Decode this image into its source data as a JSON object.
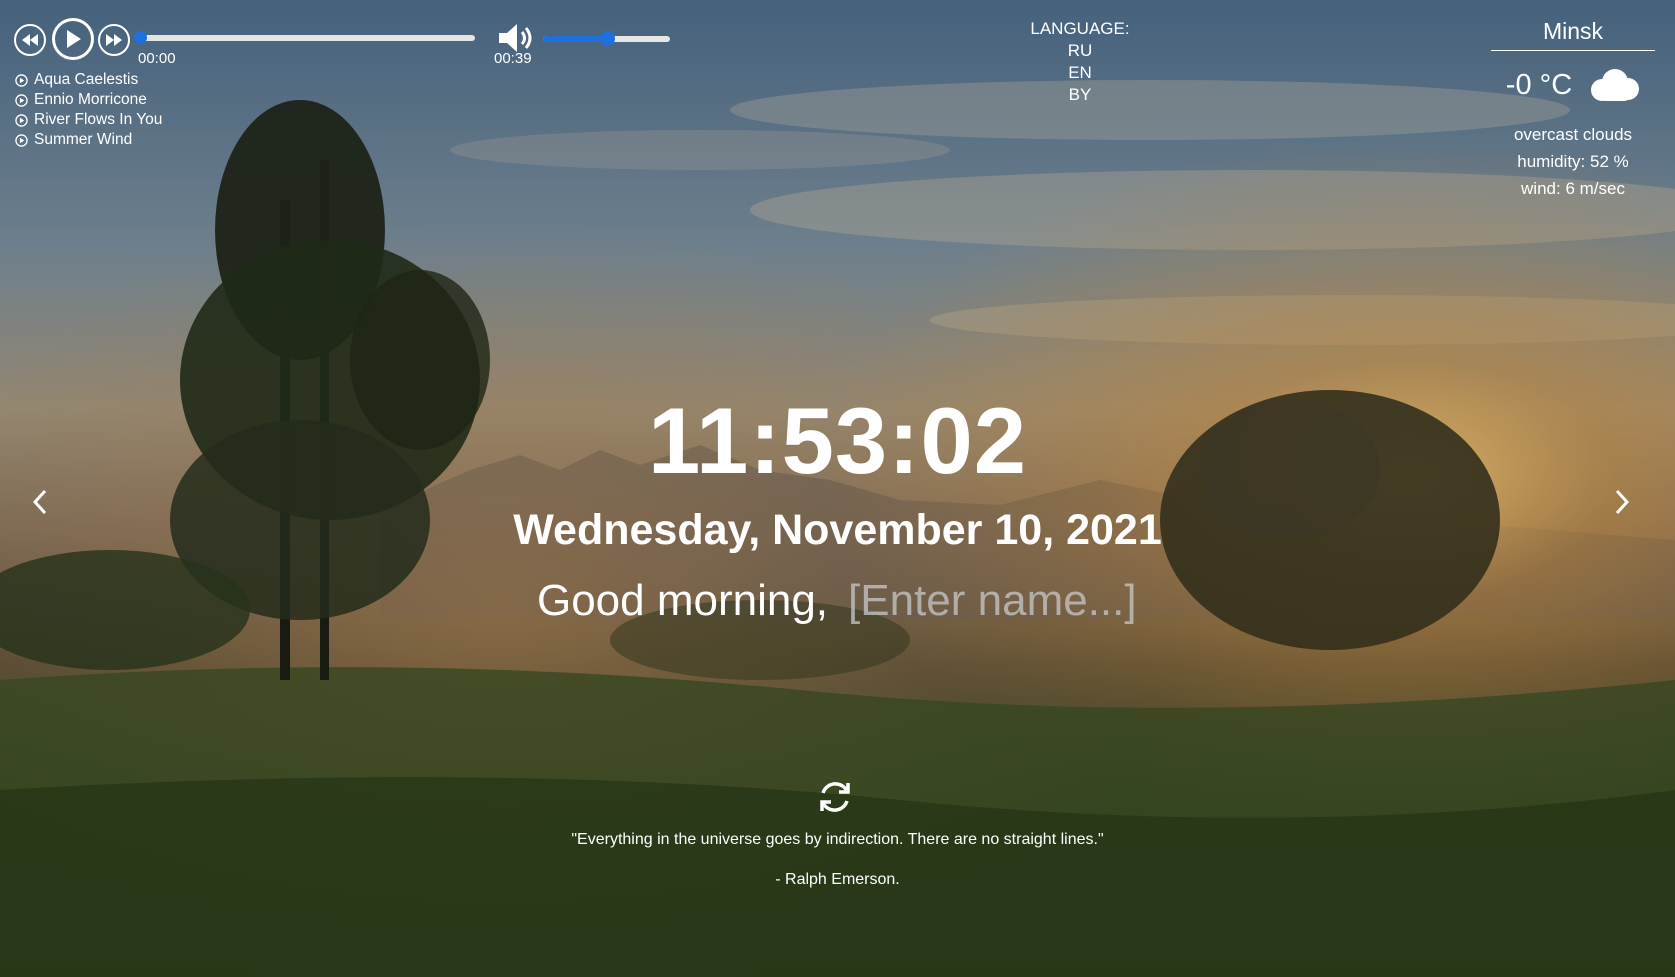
{
  "player": {
    "prev_icon": "rewind-icon",
    "play_icon": "play-icon",
    "next_icon": "fast-forward-icon",
    "current_time": "00:00",
    "total_time": "00:39",
    "progress": 0,
    "volume": 0.5,
    "volume_icon": "speaker-icon",
    "accent_color": "#1e6fe0",
    "playlist": [
      "Aqua Caelestis",
      "Ennio Morricone",
      "River Flows In You",
      "Summer Wind"
    ]
  },
  "language": {
    "label": "LANGUAGE:",
    "options": [
      "RU",
      "EN",
      "BY"
    ]
  },
  "weather": {
    "city": "Minsk",
    "temperature": "-0 °C",
    "icon": "cloud-icon",
    "description": "overcast clouds",
    "humidity": "humidity: 52 %",
    "wind": "wind: 6 m/sec"
  },
  "clock": {
    "time": "11:53:02",
    "date": "Wednesday, November 10, 2021"
  },
  "greeting": {
    "text": "Good morning,",
    "name_placeholder": "[Enter name...]"
  },
  "slider": {
    "prev_icon": "chevron-left-icon",
    "next_icon": "chevron-right-icon"
  },
  "quote": {
    "refresh_icon": "refresh-icon",
    "text": "\"Everything in the universe goes by indirection. There are no straight lines.\"",
    "author": "- Ralph Emerson."
  }
}
